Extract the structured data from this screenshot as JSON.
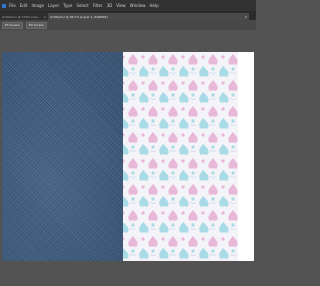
{
  "menubar": {
    "items": [
      "File",
      "Edit",
      "Image",
      "Layer",
      "Type",
      "Select",
      "Filter",
      "3D",
      "View",
      "Window",
      "Help"
    ]
  },
  "tabs": [
    {
      "label": "Untitled-1 @ 100% (Layer 0, RGB/8)"
    },
    {
      "label": "Untitled-2 @ 66.7% (Layer 1, RGB/8#)"
    }
  ],
  "options": {
    "btn1": "Fit Screen",
    "btn2": "Fill Screen"
  },
  "document": {
    "left_texture": "blue denim fabric",
    "right_texture": "pastel pink and blue damask pattern",
    "colors": {
      "denim": "#3a5a82",
      "damask_pink": "#e7b8d8",
      "damask_blue": "#a9dbe6",
      "damask_bg": "#f4f4f8"
    }
  }
}
